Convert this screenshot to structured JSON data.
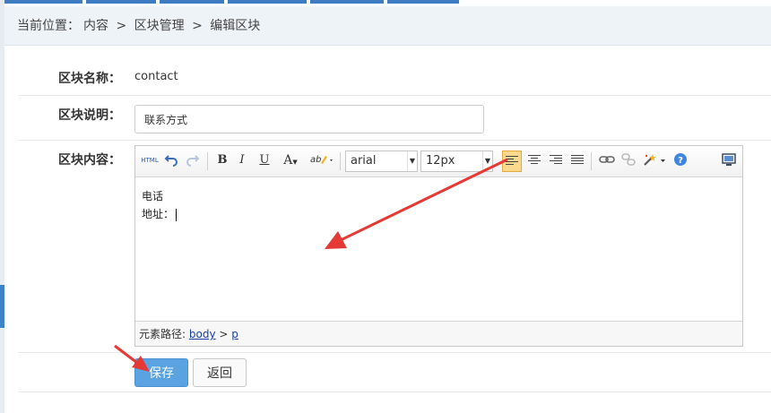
{
  "breadcrumb": {
    "prefix": "当前位置：",
    "items": [
      "内容",
      "区块管理",
      "编辑区块"
    ],
    "separator": ">"
  },
  "form": {
    "name_label": "区块名称：",
    "name_value": "contact",
    "desc_label": "区块说明：",
    "desc_value": "联系方式",
    "content_label": "区块内容："
  },
  "toolbar": {
    "html_label": "HTML",
    "bold": "B",
    "italic": "I",
    "underline": "U",
    "font_color": "A",
    "font_family": "arial",
    "font_size": "12px",
    "icons": [
      "html-icon",
      "undo-icon",
      "redo-icon",
      "bold-icon",
      "italic-icon",
      "underline-icon",
      "font-color-icon",
      "highlight-icon",
      "align-left-icon",
      "align-center-icon",
      "align-right-icon",
      "justify-icon",
      "link-icon",
      "unlink-icon",
      "magic-icon",
      "help-icon",
      "preview-icon"
    ]
  },
  "editor": {
    "lines": [
      "电话",
      "地址："
    ],
    "path_label": "元素路径:",
    "path_items": [
      "body",
      "p"
    ],
    "path_sep": ">"
  },
  "buttons": {
    "save": "保存",
    "back": "返回"
  },
  "colors": {
    "accent": "#3d7cc0",
    "save_bg": "#5aa2e0",
    "annotation": "#e53935",
    "active_align": "#fbd98c"
  }
}
